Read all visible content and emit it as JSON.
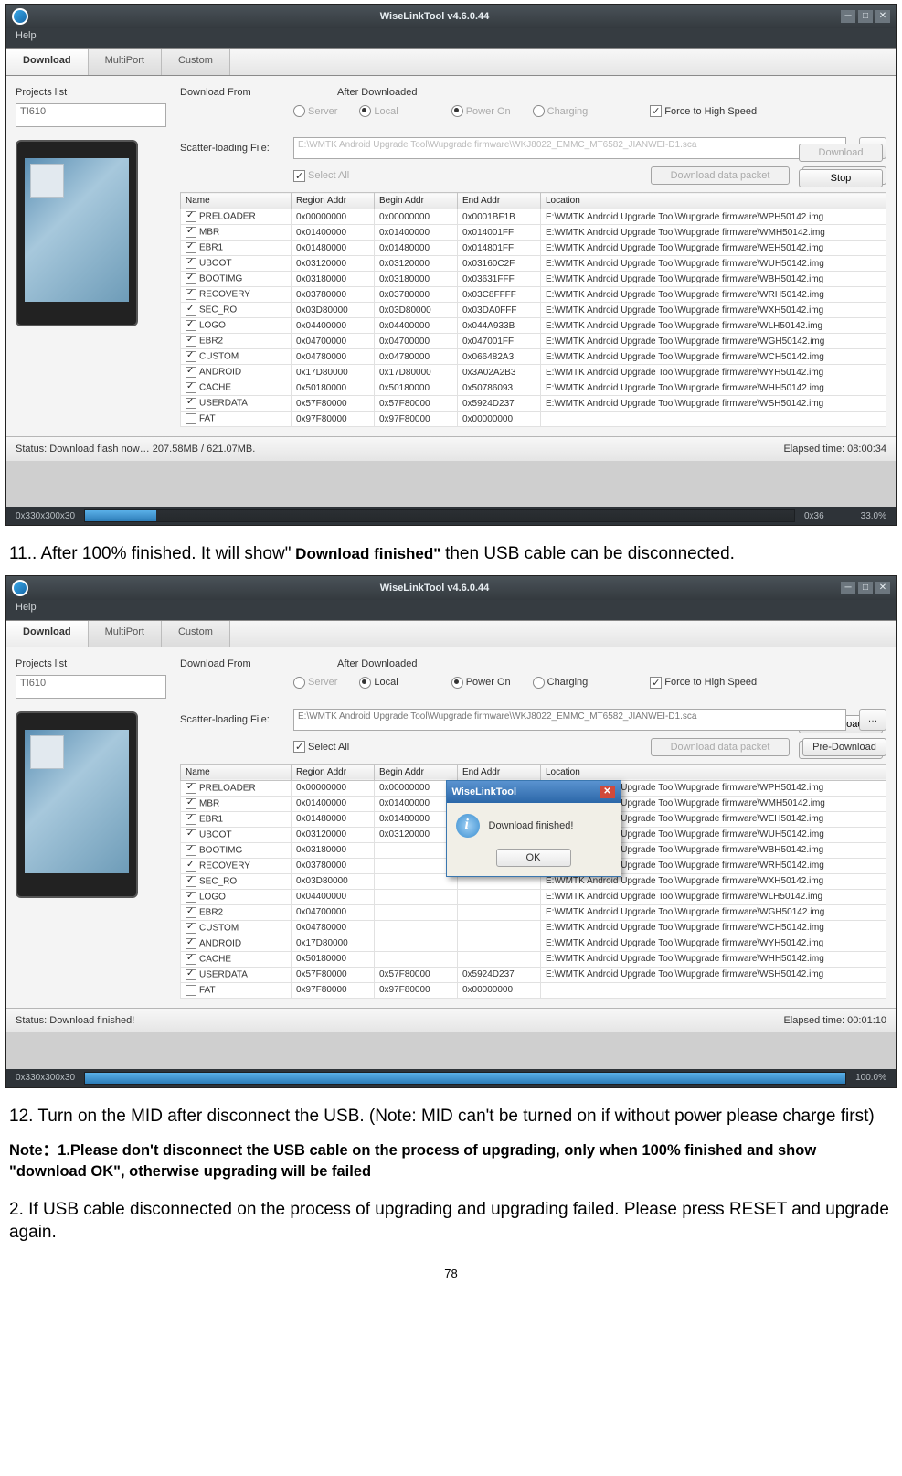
{
  "screenshot1": {
    "title": "WiseLinkTool v4.6.0.44",
    "help_menu": "Help",
    "tabs": [
      "Download",
      "MultiPort",
      "Custom"
    ],
    "projects_label": "Projects list",
    "project_value": "TI610",
    "download_from_label": "Download From",
    "df_server": "Server",
    "df_local": "Local",
    "after_label": "After Downloaded",
    "ad_poweron": "Power On",
    "ad_charging": "Charging",
    "force_label": "Force to High Speed",
    "btn_download": "Download",
    "btn_stop": "Stop",
    "scatter_label": "Scatter-loading File:",
    "scatter_path": "E:\\WMTK Android Upgrade Tool\\Wupgrade firmware\\WKJ8022_EMMC_MT6582_JIANWEI-D1.sca",
    "select_all": "Select All",
    "btn_ddp": "Download data packet",
    "btn_pred": "Pre-Download",
    "headers": {
      "name": "Name",
      "region": "Region Addr",
      "begin": "Begin Addr",
      "end": "End Addr",
      "loc": "Location"
    },
    "rows": [
      {
        "c": true,
        "n": "PRELOADER",
        "r": "0x00000000",
        "b": "0x00000000",
        "e": "0x0001BF1B",
        "l": "E:\\WMTK Android Upgrade Tool\\Wupgrade firmware\\WPH50142.img"
      },
      {
        "c": true,
        "n": "MBR",
        "r": "0x01400000",
        "b": "0x01400000",
        "e": "0x014001FF",
        "l": "E:\\WMTK Android Upgrade Tool\\Wupgrade firmware\\WMH50142.img"
      },
      {
        "c": true,
        "n": "EBR1",
        "r": "0x01480000",
        "b": "0x01480000",
        "e": "0x014801FF",
        "l": "E:\\WMTK Android Upgrade Tool\\Wupgrade firmware\\WEH50142.img"
      },
      {
        "c": true,
        "n": "UBOOT",
        "r": "0x03120000",
        "b": "0x03120000",
        "e": "0x03160C2F",
        "l": "E:\\WMTK Android Upgrade Tool\\Wupgrade firmware\\WUH50142.img"
      },
      {
        "c": true,
        "n": "BOOTIMG",
        "r": "0x03180000",
        "b": "0x03180000",
        "e": "0x03631FFF",
        "l": "E:\\WMTK Android Upgrade Tool\\Wupgrade firmware\\WBH50142.img"
      },
      {
        "c": true,
        "n": "RECOVERY",
        "r": "0x03780000",
        "b": "0x03780000",
        "e": "0x03C8FFFF",
        "l": "E:\\WMTK Android Upgrade Tool\\Wupgrade firmware\\WRH50142.img"
      },
      {
        "c": true,
        "n": "SEC_RO",
        "r": "0x03D80000",
        "b": "0x03D80000",
        "e": "0x03DA0FFF",
        "l": "E:\\WMTK Android Upgrade Tool\\Wupgrade firmware\\WXH50142.img"
      },
      {
        "c": true,
        "n": "LOGO",
        "r": "0x04400000",
        "b": "0x04400000",
        "e": "0x044A933B",
        "l": "E:\\WMTK Android Upgrade Tool\\Wupgrade firmware\\WLH50142.img"
      },
      {
        "c": true,
        "n": "EBR2",
        "r": "0x04700000",
        "b": "0x04700000",
        "e": "0x047001FF",
        "l": "E:\\WMTK Android Upgrade Tool\\Wupgrade firmware\\WGH50142.img"
      },
      {
        "c": true,
        "n": "CUSTOM",
        "r": "0x04780000",
        "b": "0x04780000",
        "e": "0x066482A3",
        "l": "E:\\WMTK Android Upgrade Tool\\Wupgrade firmware\\WCH50142.img"
      },
      {
        "c": true,
        "n": "ANDROID",
        "r": "0x17D80000",
        "b": "0x17D80000",
        "e": "0x3A02A2B3",
        "l": "E:\\WMTK Android Upgrade Tool\\Wupgrade firmware\\WYH50142.img"
      },
      {
        "c": true,
        "n": "CACHE",
        "r": "0x50180000",
        "b": "0x50180000",
        "e": "0x50786093",
        "l": "E:\\WMTK Android Upgrade Tool\\Wupgrade firmware\\WHH50142.img"
      },
      {
        "c": true,
        "n": "USERDATA",
        "r": "0x57F80000",
        "b": "0x57F80000",
        "e": "0x5924D237",
        "l": "E:\\WMTK Android Upgrade Tool\\Wupgrade firmware\\WSH50142.img"
      },
      {
        "c": false,
        "n": "FAT",
        "r": "0x97F80000",
        "b": "0x97F80000",
        "e": "0x00000000",
        "l": ""
      }
    ],
    "status": "Status:   Download flash now… 207.58MB / 621.07MB.",
    "elapsed": "Elapsed time: 08:00:34",
    "bottom_left": "0x330x300x30",
    "bottom_mid": "0x36",
    "bottom_right": "33.0%"
  },
  "doc": {
    "p11a": "11.. After 100% finished. It will show\"",
    "p11b": " Download finished\" ",
    "p11c": "then USB cable can be disconnected.",
    "p12": "12.    Turn on the MID after disconnect the USB. (Note: MID can't be turned on if without power please charge first)",
    "note1": "Note：1.Please don't disconnect the USB cable on the process of upgrading, only when 100% finished and show \"download OK\", otherwise upgrading will be failed",
    "p2": "2. If USB cable disconnected on the process of upgrading and upgrading failed. Please press RESET and upgrade again.",
    "pg": "78"
  },
  "screenshot2": {
    "title": "WiseLinkTool v4.6.0.44",
    "status": "Status:  Download finished!",
    "elapsed": "Elapsed time: 00:01:10",
    "bottom_right": "100.0%",
    "scatter_path": "E:\\WMTK Android Upgrade Tool\\Wupgrade firmware\\WKJ8022_EMMC_MT6582_JIANWEI-D1.sca",
    "dlg_title": "WiseLinkTool",
    "dlg_msg": "Download finished!",
    "dlg_ok": "OK"
  }
}
